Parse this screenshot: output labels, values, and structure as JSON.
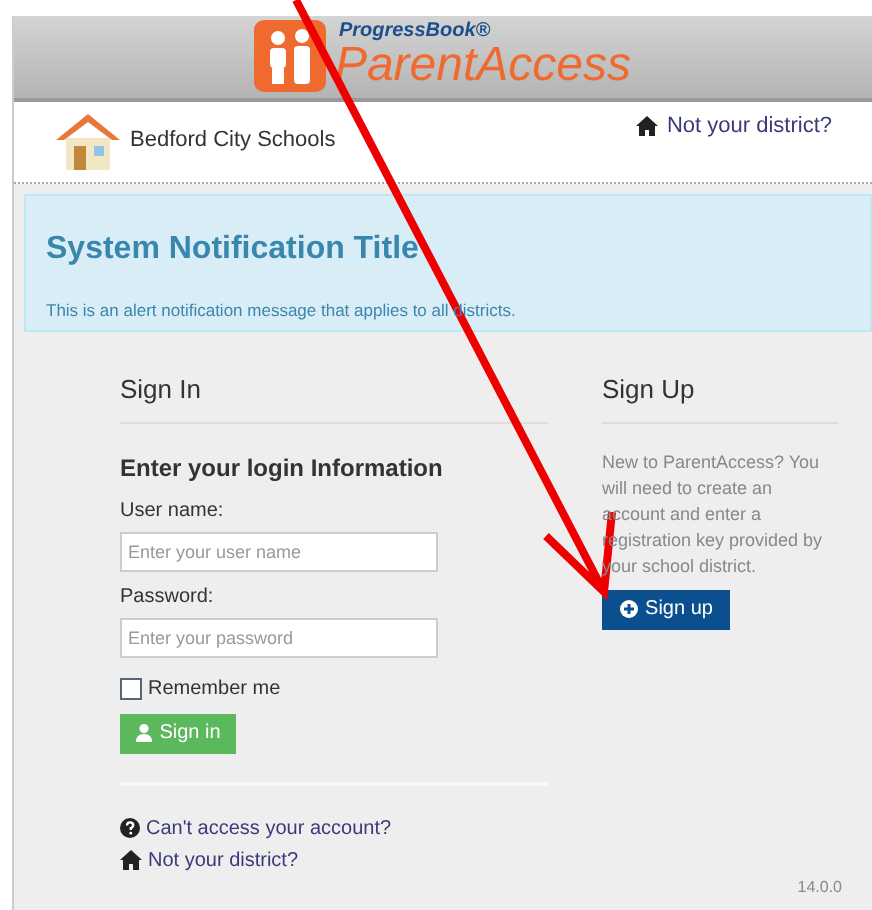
{
  "header": {
    "brand_top": "ProgressBook®",
    "brand_name": "ParentAccess"
  },
  "district_bar": {
    "district_name": "Bedford City Schools",
    "change_link": "Not your district?"
  },
  "notification": {
    "title": "System Notification Title",
    "message": "This is an alert notification message that applies to all districts."
  },
  "sign_in": {
    "title": "Sign In",
    "subtitle": "Enter your login Information",
    "fields": [
      {
        "label": "User name:",
        "placeholder": "Enter your user name"
      },
      {
        "label": "Password:",
        "placeholder": "Enter your password"
      }
    ],
    "remember": {
      "label": "Remember me",
      "checked": false
    },
    "button": "Sign in",
    "links": [
      {
        "label": "Can't access your account?",
        "kind": "help"
      },
      {
        "label": "Not your district?",
        "kind": "home"
      }
    ]
  },
  "sign_up": {
    "title": "Sign Up",
    "text": "New to ParentAccess? You will need to create an account and enter a registration key provided by your school district.",
    "button": "Sign up"
  },
  "version": "14.0.0"
}
